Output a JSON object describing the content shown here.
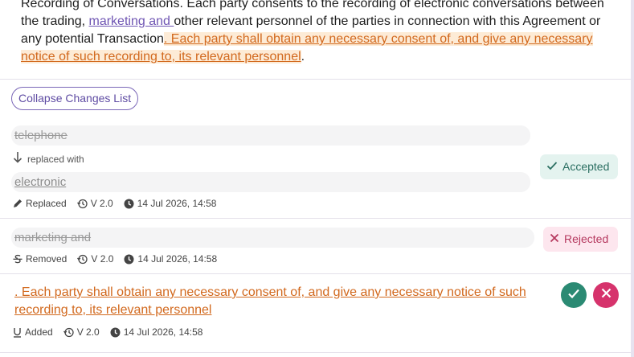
{
  "document": {
    "text_before": "Recording of Conversations. Each party consents to the recording of electronic conversations between the trading, ",
    "insert_purple": "marketing and ",
    "text_middle": "other relevant personnel of the parties in connection with this Agreement or any potential Transaction",
    "insert_orange": ". Each party shall obtain any necessary consent of, and give any necessary notice of such recording to, its relevant personnel",
    "text_after": "."
  },
  "collapse_button": {
    "label": "Collapse Changes List"
  },
  "changes": [
    {
      "old_text": "telephone",
      "replaced_with_label": "replaced with",
      "new_text": "electronic",
      "type_label": "Replaced",
      "version": "V 2.0",
      "timestamp": "14 Jul 2026, 14:58",
      "status": "Accepted"
    },
    {
      "old_text": "marketing and",
      "type_label": "Removed",
      "version": "V 2.0",
      "timestamp": "14 Jul 2026, 14:58",
      "status": "Rejected"
    },
    {
      "new_text": ". Each party shall obtain any necessary consent of, and give any necessary notice of such recording to, its relevant personnel",
      "type_label": "Added",
      "version": "V 2.0",
      "timestamp": "14 Jul 2026, 14:58",
      "status": "Pending"
    }
  ],
  "colors": {
    "accent_purple": "#6f55b3",
    "insert_orange": "#d2691e",
    "accepted_green": "#2b8a73",
    "rejected_pink": "#d6336c"
  },
  "icons": {
    "replaced": "pencil-icon",
    "removed": "strikethrough-icon",
    "added": "underline-icon",
    "version": "history-icon",
    "time": "clock-icon",
    "accepted": "check-icon",
    "rejected": "close-icon"
  }
}
